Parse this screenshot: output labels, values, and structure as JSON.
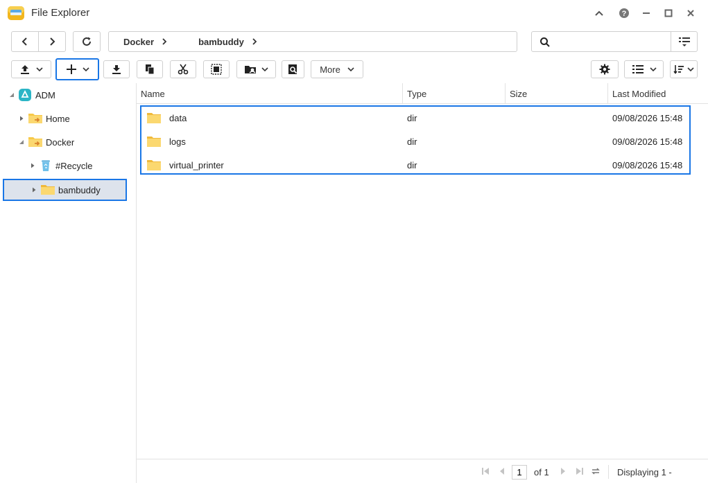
{
  "window": {
    "title": "File Explorer"
  },
  "path": {
    "crumbs": [
      "Docker",
      "bambuddy"
    ]
  },
  "search": {
    "value": "",
    "placeholder": ""
  },
  "toolbar": {
    "more_label": "More"
  },
  "tree": {
    "root": "ADM",
    "items": [
      {
        "label": "Home"
      },
      {
        "label": "Docker"
      },
      {
        "label": "#Recycle"
      },
      {
        "label": "bambuddy"
      }
    ]
  },
  "grid": {
    "columns": [
      "Name",
      "Type",
      "Size",
      "Last Modified"
    ],
    "rows": [
      {
        "name": "data",
        "type": "dir",
        "size": "",
        "modified": "09/08/2026 15:48"
      },
      {
        "name": "logs",
        "type": "dir",
        "size": "",
        "modified": "09/08/2026 15:48"
      },
      {
        "name": "virtual_printer",
        "type": "dir",
        "size": "",
        "modified": "09/08/2026 15:48"
      }
    ]
  },
  "footer": {
    "page": "1",
    "of_label": "of 1",
    "display_label": "Displaying 1 -"
  },
  "colors": {
    "accent": "#1976e6",
    "folder": "#f7c948",
    "selection": "#dde3ec"
  }
}
